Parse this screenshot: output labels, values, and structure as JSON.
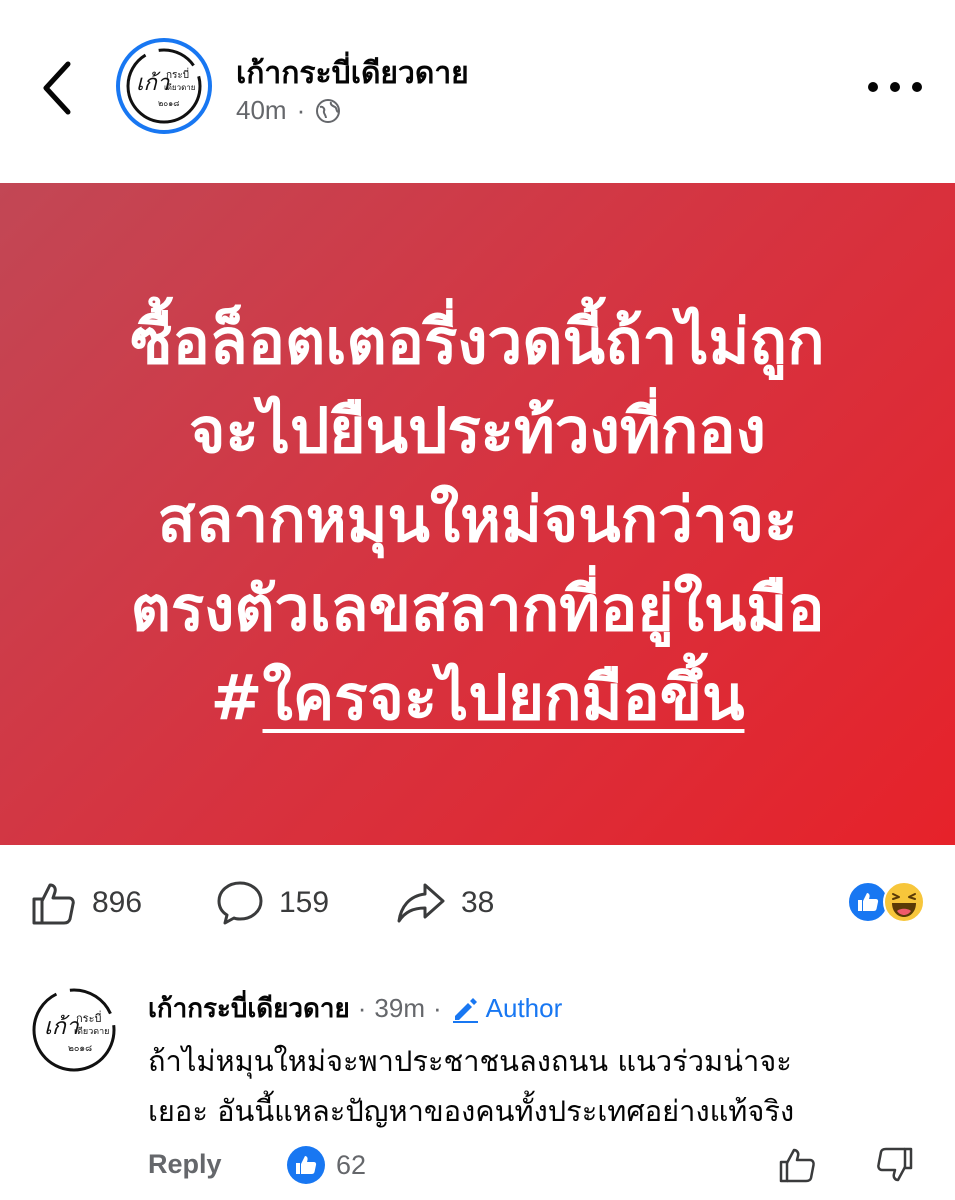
{
  "header": {
    "page_name": "เก้ากระบี่เดียวดาย",
    "time": "40m",
    "avatar_text_main": "เก้า",
    "avatar_text_sub": "กระบี่\nเดียวดาย",
    "avatar_year": "๒๐๑๘"
  },
  "post": {
    "lines": [
      "ซื้อล็อตเตอรี่งวดนี้ถ้าไม่ถูก",
      "จะไปยืนประท้วงที่กอง",
      "สลากหมุนใหม่จนกว่าจะ",
      "ตรงตัวเลขสลากที่อยู่ในมือ"
    ],
    "hashtag_symbol": "#",
    "hashtag_text": "ใครจะไปยกมือขึ้น",
    "colors": {
      "gradient_start": "#c24755",
      "gradient_end": "#e6222a",
      "text": "#ffffff"
    }
  },
  "actions": {
    "likes": "896",
    "comments": "159",
    "shares": "38"
  },
  "comment": {
    "author": "เก้ากระบี่เดียวดาย",
    "time": "39m",
    "badge": "Author",
    "body_lines": [
      "ถ้าไม่หมุนใหม่จะพาประชาชนลงถนน  แนวร่วมน่าจะ",
      "เยอะ อันนี้แหละปัญหาของคนทั้งประเทศอย่างแท้จริง"
    ],
    "reply_label": "Reply",
    "likes": "62"
  },
  "colors": {
    "accent": "#1877f2",
    "muted": "#65676b"
  }
}
